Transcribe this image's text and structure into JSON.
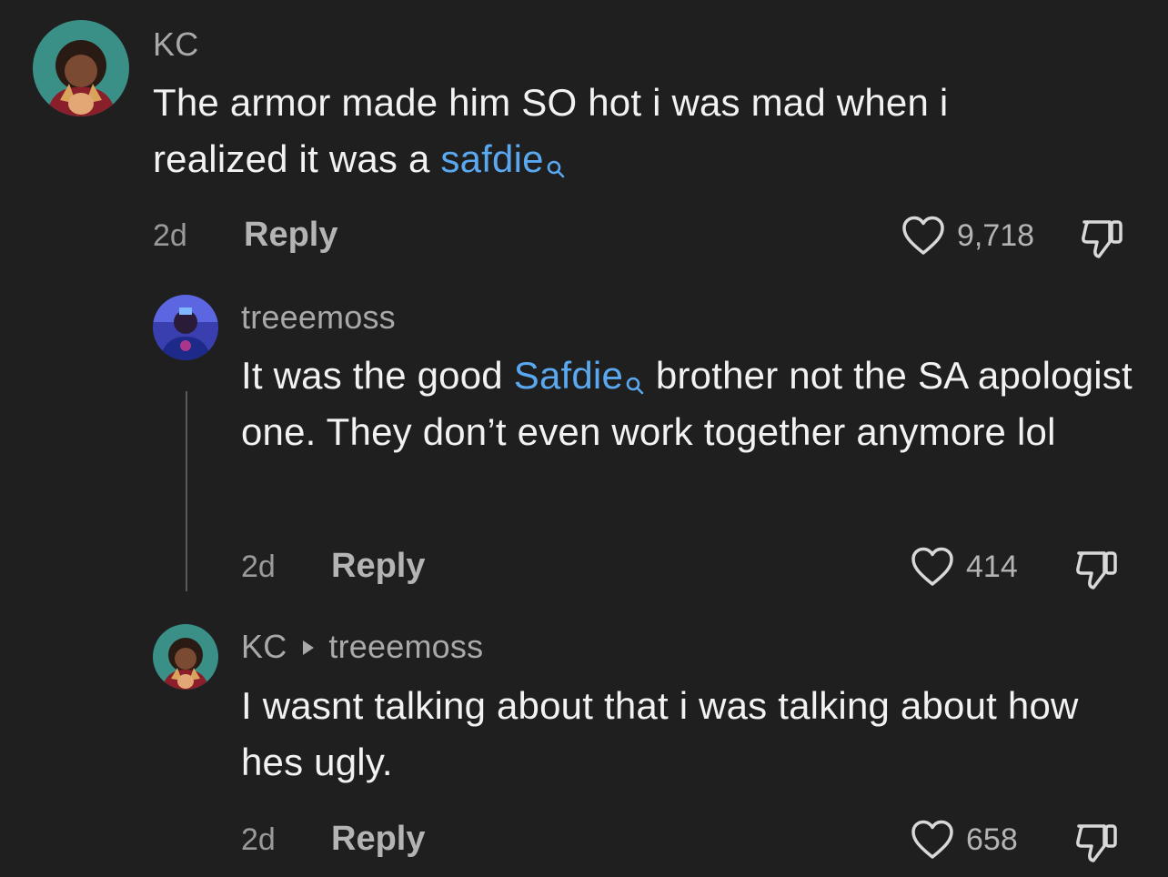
{
  "comments": [
    {
      "username": "KC",
      "text_before": "The armor made him SO hot i was mad when i realized it was a ",
      "link": "safdie",
      "text_after": "",
      "time": "2d",
      "reply_label": "Reply",
      "likes": "9,718"
    },
    {
      "username": "treeemoss",
      "text_before": "It was the good ",
      "link": "Safdie",
      "text_after": " brother not the SA apologist one. They don’t even work together anymore lol",
      "time": "2d",
      "reply_label": "Reply",
      "likes": "414"
    },
    {
      "username": "KC",
      "reply_to": "treeemoss",
      "text": "I wasnt talking about that i was talking about how hes ugly.",
      "time": "2d",
      "reply_label": "Reply",
      "likes": "658"
    }
  ],
  "colors": {
    "background": "#1f1f1f",
    "link": "#5aa8f0",
    "muted": "#a9a9a9"
  },
  "icons": [
    "heart-icon",
    "dislike-icon",
    "search-icon",
    "triangle-right-icon"
  ]
}
